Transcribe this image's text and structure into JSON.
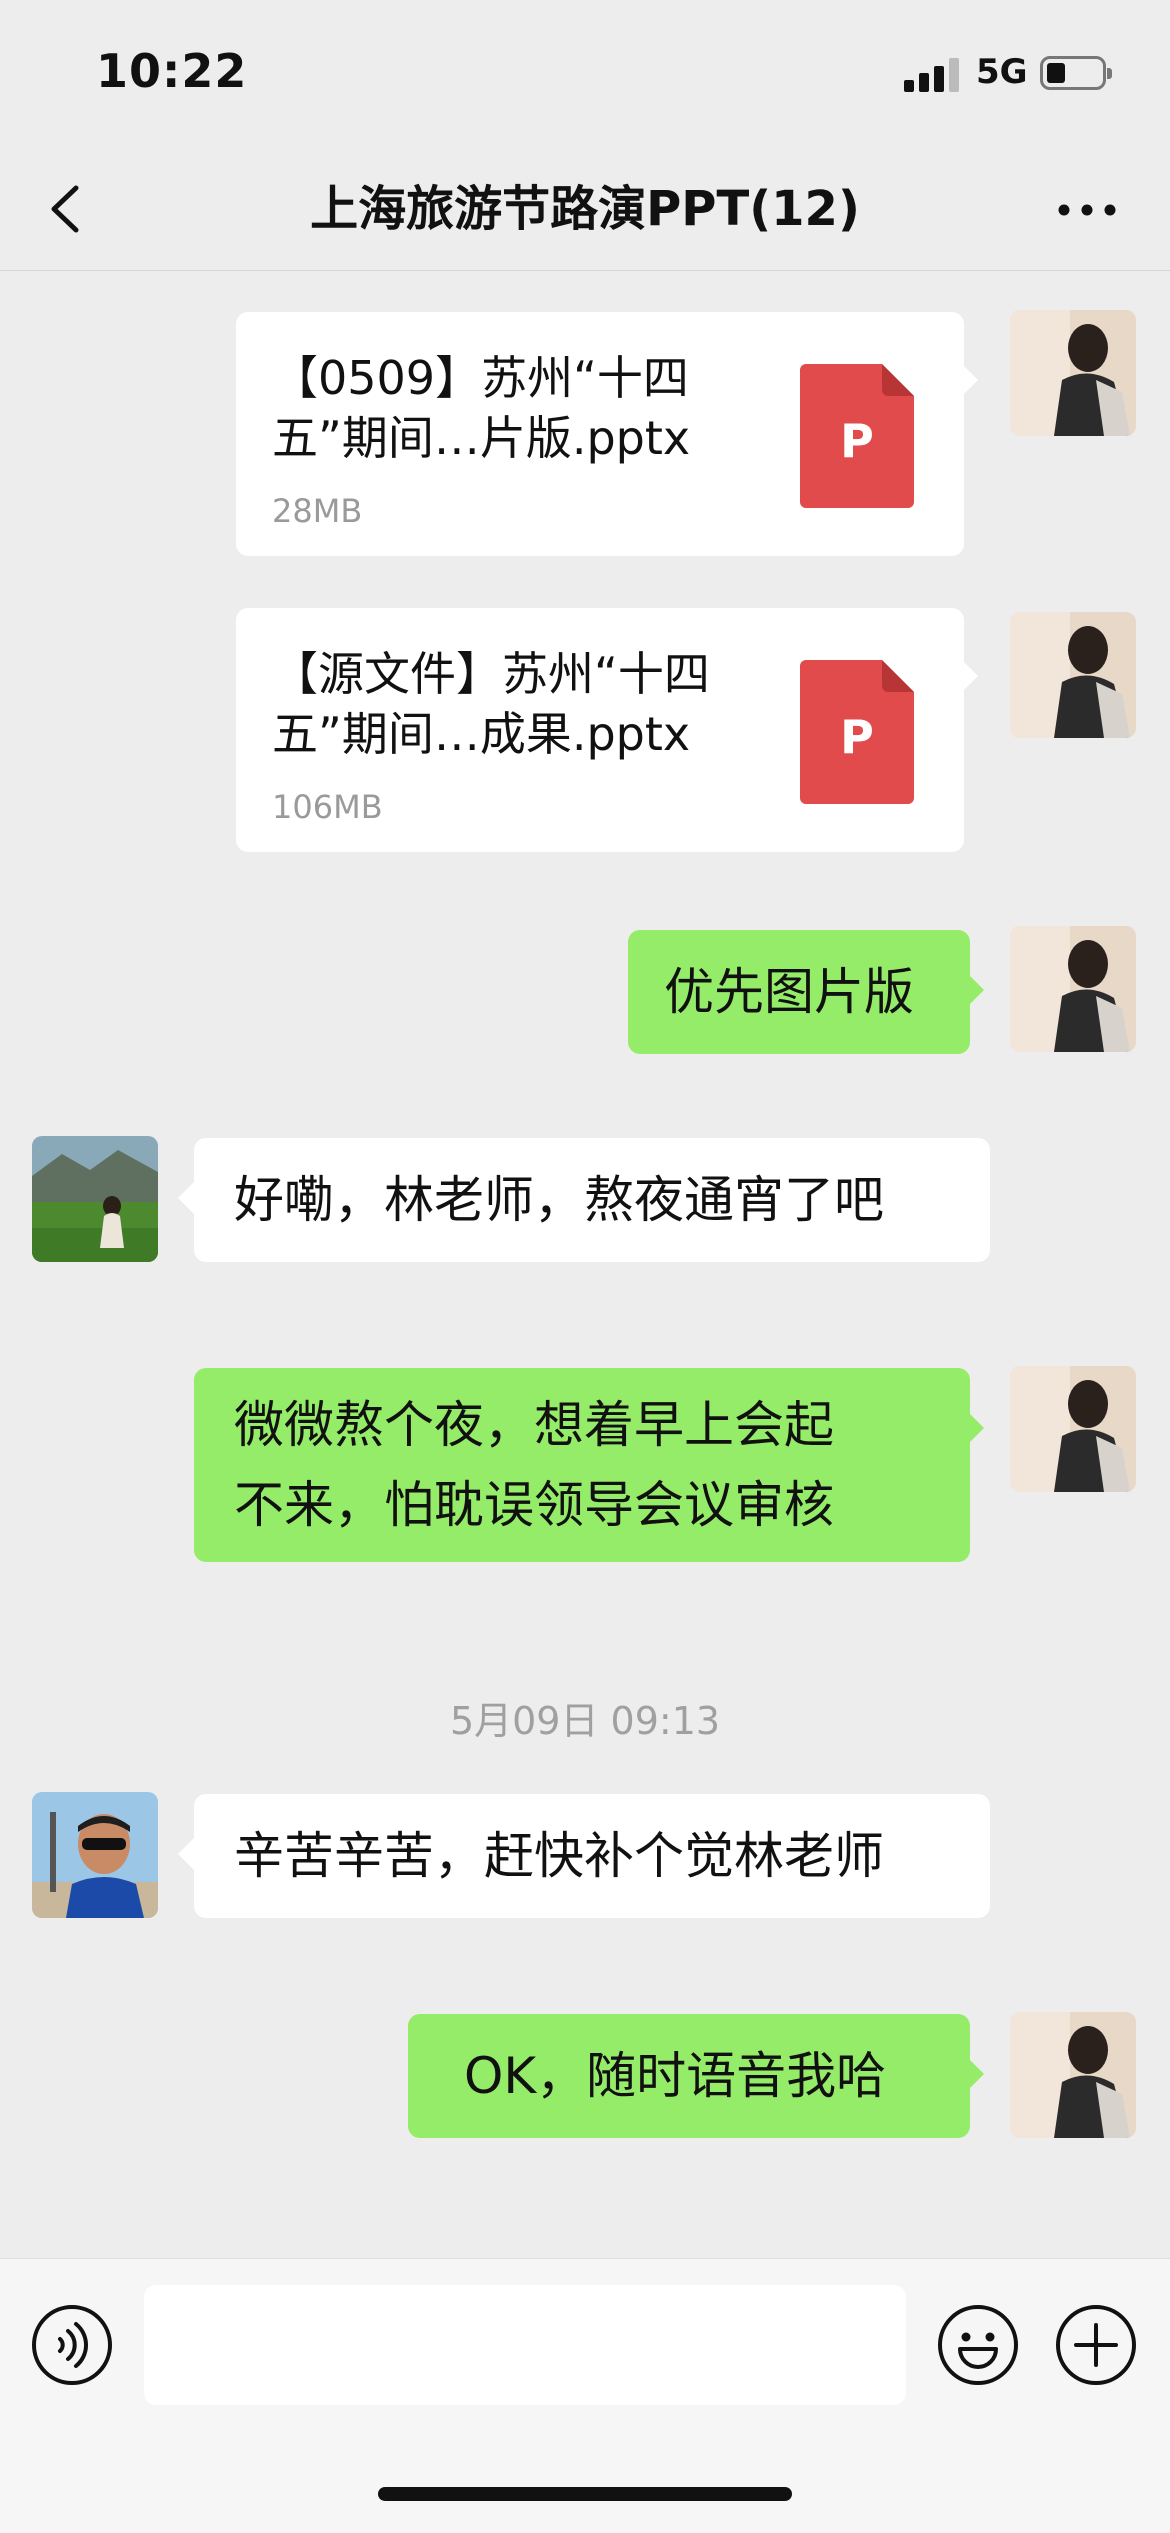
{
  "status_bar": {
    "time": "10:22",
    "network": "5G"
  },
  "nav": {
    "title": "上海旅游节路演PPT(12)"
  },
  "messages": [
    {
      "type": "file",
      "side": "right",
      "name_line1": "【0509】苏州“十四",
      "name_line2": "五”期间…片版.pptx",
      "size": "28MB",
      "file_icon_label": "P"
    },
    {
      "type": "file",
      "side": "right",
      "name_line1": "【源文件】苏州“十四",
      "name_line2": "五”期间…成果.pptx",
      "size": "106MB",
      "file_icon_label": "P"
    },
    {
      "type": "text",
      "side": "right",
      "text": "优先图片版"
    },
    {
      "type": "text",
      "side": "left",
      "text": "好嘞，林老师，熬夜通宵了吧"
    },
    {
      "type": "text",
      "side": "right",
      "line1": "微微熬个夜，想着早上会起",
      "line2": "不来，怕耽误领导会议审核"
    },
    {
      "type": "timestamp",
      "text": "5月09日 09:13"
    },
    {
      "type": "text",
      "side": "left",
      "text": "辛苦辛苦，赶快补个觉林老师"
    },
    {
      "type": "text",
      "side": "right",
      "text": "OK，随时语音我哈"
    }
  ],
  "colors": {
    "background": "#ededed",
    "self_bubble": "#95ec69",
    "other_bubble": "#ffffff",
    "ppt_icon": "#e24b4b"
  },
  "icons": {
    "back": "chevron-left-icon",
    "more": "more-dots-icon",
    "voice": "voice-icon",
    "emoji": "emoji-icon",
    "add": "plus-icon"
  }
}
